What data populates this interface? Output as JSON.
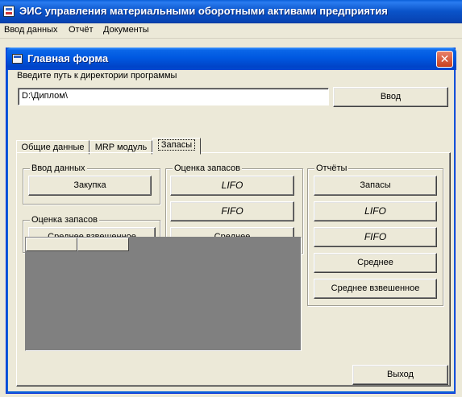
{
  "app": {
    "title": "ЭИС управления материальными оборотными активами предприятия",
    "icon": "app-window-icon"
  },
  "menu": {
    "items": [
      {
        "label": "Ввод данных"
      },
      {
        "label": "Отчёт"
      },
      {
        "label": "Документы"
      }
    ]
  },
  "window": {
    "title": "Главная форма",
    "close_label": "✕"
  },
  "path": {
    "label": "Введите путь к директории программы",
    "value": "D:\\Диплом\\",
    "enter_button": "Ввод"
  },
  "tabs": [
    {
      "label": "Общие данные",
      "active": false
    },
    {
      "label": "MRP модуль",
      "active": false
    },
    {
      "label": "Запасы",
      "active": true
    }
  ],
  "groups": {
    "data_input": {
      "label": "Ввод данных",
      "purchase_button": "Закупка"
    },
    "stock_eval_small": {
      "label": "Оценка запасов",
      "weighted_avg_button": "Среднее взвешенное"
    },
    "stock_eval": {
      "label": "Оценка запасов",
      "lifo_button": "LIFO",
      "fifo_button": "FIFO",
      "average_button": "Среднее"
    },
    "reports": {
      "label": "Отчёты",
      "stock_button": "Запасы",
      "lifo_button": "LIFO",
      "fifo_button": "FIFO",
      "average_button": "Среднее",
      "weighted_avg_button": "Среднее взвешенное"
    }
  },
  "footer": {
    "exit_button": "Выход"
  }
}
